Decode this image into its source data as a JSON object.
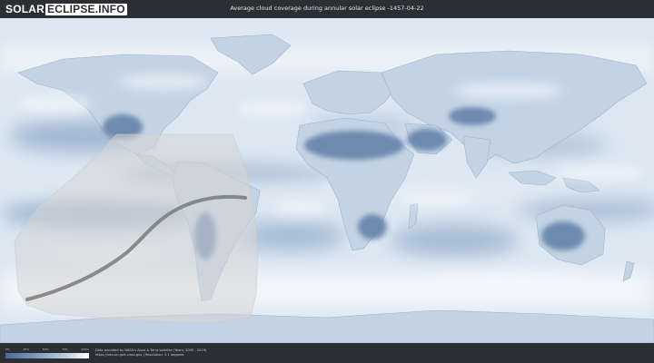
{
  "header": {
    "logo_part1": "SOLAR",
    "logo_part2": "ECLIPSE.INFO",
    "title": "Average cloud coverage during annular solar eclipse -1457-04-22"
  },
  "legend": {
    "ticks": [
      "0%",
      "25%",
      "50%",
      "75%",
      "100%"
    ],
    "colors": {
      "low": "#4a6a94",
      "mid": "#b8cadd",
      "high": "#ffffff"
    }
  },
  "credits": {
    "line1": "Data provided by NASA's Aqua & Terra satellite (Years: 2000 - 2019)",
    "line2": "https://neo.sci.gsfc.nasa.gov | Resolution: 0.1 degrees"
  },
  "colors": {
    "bar_bg": "#2b2e32",
    "ocean_clear": "#6f8fb4",
    "cloud": "#eef3f8",
    "eclipse_zone": "#d8d8d8",
    "central_line": "#7a7a7a"
  }
}
